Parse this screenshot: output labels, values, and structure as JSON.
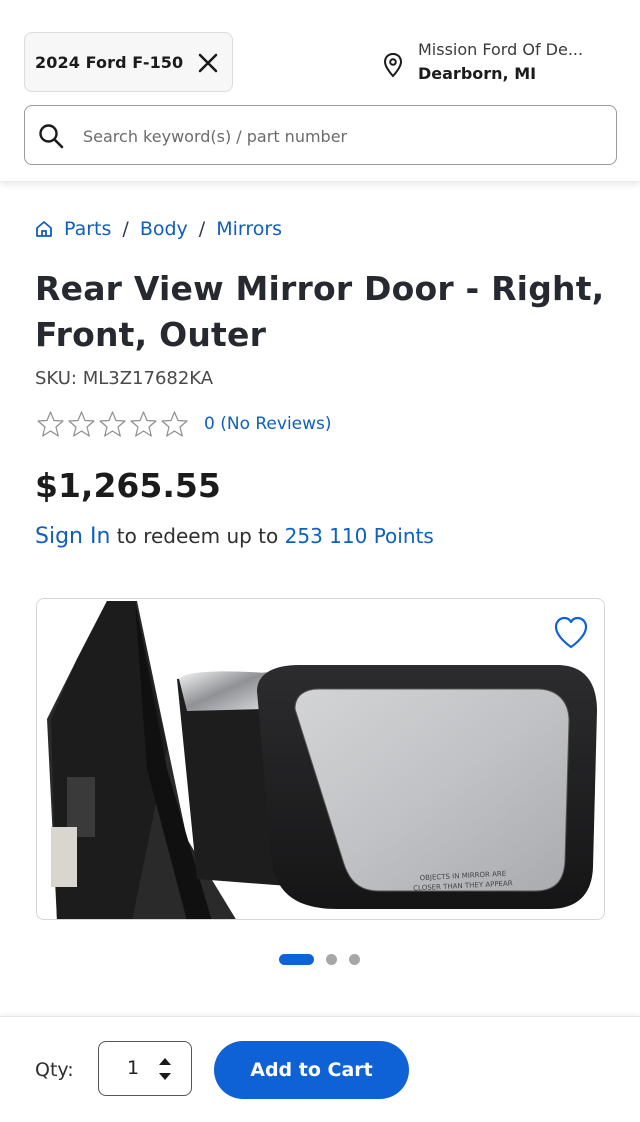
{
  "header": {
    "vehicle": "2024 Ford F-150",
    "dealer_name": "Mission Ford Of De...",
    "dealer_city": "Dearborn, MI",
    "search_placeholder": "Search keyword(s) / part number"
  },
  "breadcrumb": {
    "items": [
      "Parts",
      "Body",
      "Mirrors"
    ],
    "separator": "/"
  },
  "product": {
    "title": "Rear View Mirror Door - Right, Front, Outer",
    "sku": "SKU: ML3Z17682KA",
    "rating_stars": 0,
    "rating_max": 5,
    "reviews": "0 (No Reviews)",
    "price": "$1,265.55",
    "points_signin": "Sign In",
    "points_middle": "to redeem up to",
    "points_value": "253 110 Points",
    "mirror_text_line1": "OBJECTS IN MIRROR ARE",
    "mirror_text_line2": "CLOSER THAN THEY APPEAR"
  },
  "gallery": {
    "total_images": 3,
    "active_index": 0
  },
  "cart": {
    "qty_label": "Qty:",
    "qty_value": "1",
    "add_label": "Add to Cart"
  },
  "colors": {
    "brand_blue": "#0f62d6",
    "link_blue": "#0e5fc2"
  },
  "icons": [
    "close-icon",
    "location-pin-icon",
    "search-icon",
    "home-icon",
    "star-outline-icon",
    "heart-outline-icon",
    "stepper-icon"
  ]
}
